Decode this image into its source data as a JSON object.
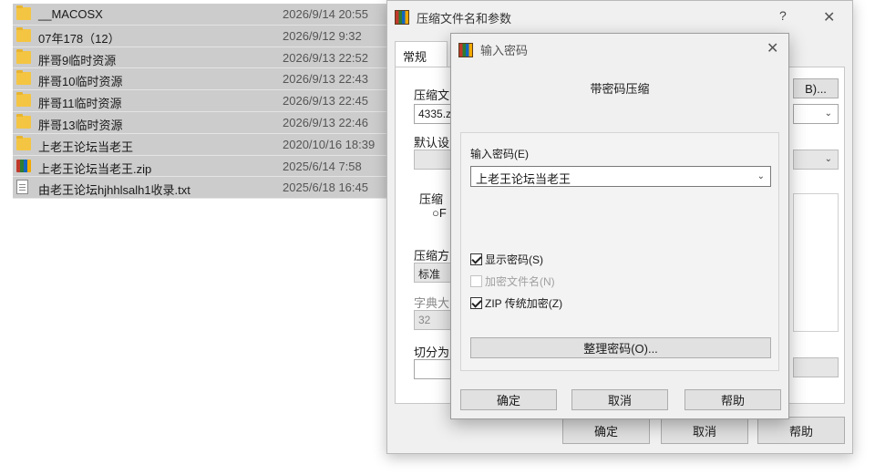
{
  "files": [
    {
      "name": "__MACOSX",
      "date": "2026/9/14 20:55",
      "type": "folder"
    },
    {
      "name": "07年178（12）",
      "date": "2026/9/12 9:32",
      "type": "folder"
    },
    {
      "name": "胖哥9临时资源",
      "date": "2026/9/13 22:52",
      "type": "folder"
    },
    {
      "name": "胖哥10临时资源",
      "date": "2026/9/13 22:43",
      "type": "folder"
    },
    {
      "name": "胖哥11临时资源",
      "date": "2026/9/13 22:45",
      "type": "folder"
    },
    {
      "name": "胖哥13临时资源",
      "date": "2026/9/13 22:46",
      "type": "folder"
    },
    {
      "name": "上老王论坛当老王",
      "date": "2020/10/16 18:39",
      "type": "folder"
    },
    {
      "name": "上老王论坛当老王.zip",
      "date": "2025/6/14 7:58",
      "type": "zip"
    },
    {
      "name": "由老王论坛hjhhlsalh1收录.txt",
      "date": "2025/6/18 16:45",
      "type": "txt"
    }
  ],
  "main_dialog": {
    "title": "压缩文件名和参数",
    "help": "?",
    "close": "✕",
    "tab_general": "常规",
    "archive_name_label": "压缩文",
    "archive_name_value": "4335.z",
    "browse_label": "B)...",
    "default_label": "默认设",
    "compress_group_label": "压缩",
    "radio_label": "F",
    "method_label": "压缩方",
    "method_value": "标准",
    "dict_label": "字典大",
    "dict_value": "32",
    "split_label": "切分为",
    "ok": "确定",
    "cancel": "取消",
    "help_btn": "帮助"
  },
  "password_dialog": {
    "title": "输入密码",
    "close": "✕",
    "heading": "带密码压缩",
    "enter_label": "输入密码(E)",
    "password_value": "上老王论坛当老王",
    "show_password": "显示密码(S)",
    "encrypt_names": "加密文件名(N)",
    "zip_legacy": "ZIP 传统加密(Z)",
    "organize": "整理密码(O)...",
    "ok": "确定",
    "cancel": "取消",
    "help": "帮助",
    "show_password_checked": true,
    "encrypt_names_checked": false,
    "encrypt_names_enabled": false,
    "zip_legacy_checked": true
  }
}
